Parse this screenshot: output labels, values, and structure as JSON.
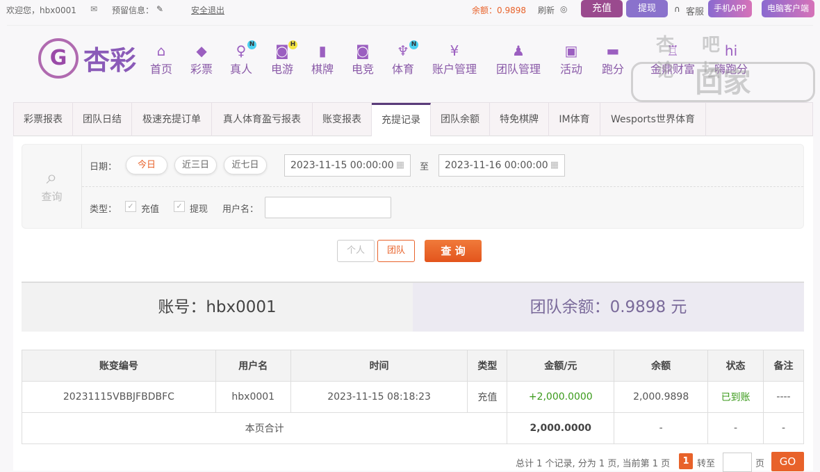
{
  "topbar": {
    "welcome": "欢迎您，hbx0001",
    "reserved_label": "预留信息：",
    "logout": "安全退出",
    "balance": "余额：0.9898",
    "refresh": "刷新",
    "deposit": "充值",
    "withdraw": "提现",
    "service": "客服",
    "mobile_app": "手机APP",
    "pc_client": "电脑客户端"
  },
  "logo": {
    "text": "杏彩"
  },
  "nav": [
    {
      "label": "首页",
      "icon": "home-icon"
    },
    {
      "label": "彩票",
      "icon": "ticket-icon"
    },
    {
      "label": "真人",
      "icon": "woman-icon",
      "badge": "N"
    },
    {
      "label": "电游",
      "icon": "gamepad-icon",
      "badge": "H"
    },
    {
      "label": "棋牌",
      "icon": "cards-icon"
    },
    {
      "label": "电竞",
      "icon": "gamepad-icon"
    },
    {
      "label": "体育",
      "icon": "trophy-icon",
      "badge": "N"
    },
    {
      "label": "账户管理",
      "icon": "yen-icon"
    },
    {
      "label": "团队管理",
      "icon": "team-icon"
    },
    {
      "label": "活动",
      "icon": "gift-icon"
    },
    {
      "label": "跑分",
      "icon": "rhino-icon"
    },
    {
      "label": "金鼎财富",
      "icon": "chair-icon"
    },
    {
      "label": "嗨跑分",
      "icon": "hi-icon"
    }
  ],
  "watermark": {
    "line1": "杏吧 论坛",
    "line2": "回家150.com"
  },
  "tabs": [
    "彩票报表",
    "团队日结",
    "极速充提订单",
    "真人体育盈亏报表",
    "账变报表",
    "充提记录",
    "团队余额",
    "特免棋牌",
    "IM体育",
    "Wesports世界体育"
  ],
  "active_tab": 5,
  "filter": {
    "search_label": "查询",
    "date_label": "日期：",
    "today": "今日",
    "three_days": "近三日",
    "seven_days": "近七日",
    "start": "2023-11-15 00:00:00",
    "to": "至",
    "end": "2023-11-16 00:00:00",
    "type_label": "类型：",
    "type_deposit": "充值",
    "type_withdraw": "提现",
    "username_label": "用户名：",
    "username_value": ""
  },
  "actions": {
    "personal": "个人",
    "team": "团队",
    "query": "查 询"
  },
  "summary": {
    "account": "账号：hbx0001",
    "team_balance": "团队余额：0.9898 元"
  },
  "table": {
    "headers": [
      "账变编号",
      "用户名",
      "时间",
      "类型",
      "金额/元",
      "余额",
      "状态",
      "备注"
    ],
    "rows": [
      [
        "20231115VBBJFBDBFC",
        "hbx0001",
        "2023-11-15 08:18:23",
        "充值",
        "+2,000.0000",
        "2,000.9898",
        "已到账",
        "----"
      ]
    ],
    "total": {
      "label": "本页合计",
      "amount": "2,000.0000",
      "balance": "-",
      "status": "-",
      "remark": "-"
    }
  },
  "pagination": {
    "info": "总计 1 个记录, 分为 1 页, 当前第 1 页",
    "current": "1",
    "goto": "转至",
    "page": "页",
    "go": "GO"
  },
  "colors": {
    "accent": "#e8622a",
    "purple": "#8a5aa8",
    "green": "#3a9a1a"
  }
}
